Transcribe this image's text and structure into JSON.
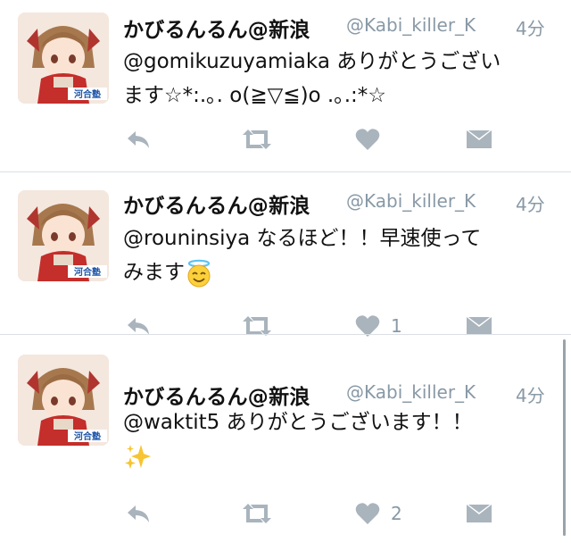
{
  "tweets": [
    {
      "name": "かびるんるん@新浪",
      "handle": "@Kabi_killer_K",
      "time": "4分",
      "mention": "@gomikuzuyamiaka",
      "text_line1": "ありがとうござい",
      "text_line2": "ます☆*:.｡. o(≧▽≦)o .｡.:*☆",
      "like_count": "",
      "avatar_badge": "河合塾"
    },
    {
      "name": "かびるんるん@新浪",
      "handle": "@Kabi_killer_K",
      "time": "4分",
      "mention": "@rouninsiya",
      "text_line1": "なるほど！！早速使って",
      "text_line2": "みます",
      "like_count": "1",
      "avatar_badge": "河合塾"
    },
    {
      "name": "かびるんるん@新浪",
      "handle": "@Kabi_killer_K",
      "time": "4分",
      "mention": "@waktit5",
      "text_line1": "ありがとうございます！！",
      "text_line2": "",
      "like_count": "2",
      "avatar_badge": "河合塾"
    }
  ],
  "icons": {
    "reply": "reply-icon",
    "retweet": "retweet-icon",
    "like": "heart-icon",
    "dm": "envelope-icon",
    "emoji_halo": "smiling-face-with-halo-icon",
    "emoji_sparkles": "sparkles-icon"
  },
  "colors": {
    "action_gray": "#a9b4bd",
    "meta_gray": "#8899a6",
    "divider": "#dbe0e4"
  }
}
